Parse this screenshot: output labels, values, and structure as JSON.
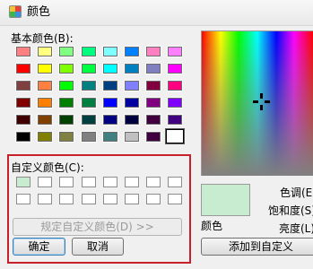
{
  "window": {
    "title": "颜色"
  },
  "basic": {
    "label": "基本颜色(B):",
    "rows": [
      [
        "#ff8080",
        "#ffff80",
        "#80ff80",
        "#00ff80",
        "#80ffff",
        "#0080ff",
        "#ff80c0",
        "#ff80ff"
      ],
      [
        "#ff0000",
        "#ffff00",
        "#80ff00",
        "#00ff40",
        "#00ffff",
        "#0080c0",
        "#8080c0",
        "#ff00ff"
      ],
      [
        "#804040",
        "#ff8040",
        "#00ff00",
        "#008080",
        "#004080",
        "#8080ff",
        "#800040",
        "#ff0080"
      ],
      [
        "#800000",
        "#ff8000",
        "#008000",
        "#008040",
        "#0000ff",
        "#0000a0",
        "#800080",
        "#8000ff"
      ],
      [
        "#400000",
        "#804000",
        "#004000",
        "#004040",
        "#000080",
        "#000040",
        "#400040",
        "#400080"
      ],
      [
        "#000000",
        "#808000",
        "#808040",
        "#808080",
        "#408080",
        "#c0c0c0",
        "#400040",
        "#ffffff"
      ]
    ]
  },
  "custom": {
    "label": "自定义颜色(C):",
    "rows": [
      [
        "#c8ecd0",
        "#ffffff",
        "#ffffff",
        "#ffffff",
        "#ffffff",
        "#ffffff",
        "#ffffff",
        "#ffffff"
      ],
      [
        "#ffffff",
        "#ffffff",
        "#ffffff",
        "#ffffff",
        "#ffffff",
        "#ffffff",
        "#ffffff",
        "#ffffff"
      ]
    ]
  },
  "buttons": {
    "define_custom": "规定自定义颜色(D) >>",
    "ok": "确定",
    "cancel": "取消",
    "add_to_custom": "添加到自定义"
  },
  "preview": {
    "color": "#c8ecd0",
    "label": "颜色"
  },
  "fields": {
    "hue": "色调(E)",
    "saturation": "饱和度(S)",
    "luminance": "亮度(L)"
  },
  "colors": {
    "highlight_box": "#c8202a"
  }
}
